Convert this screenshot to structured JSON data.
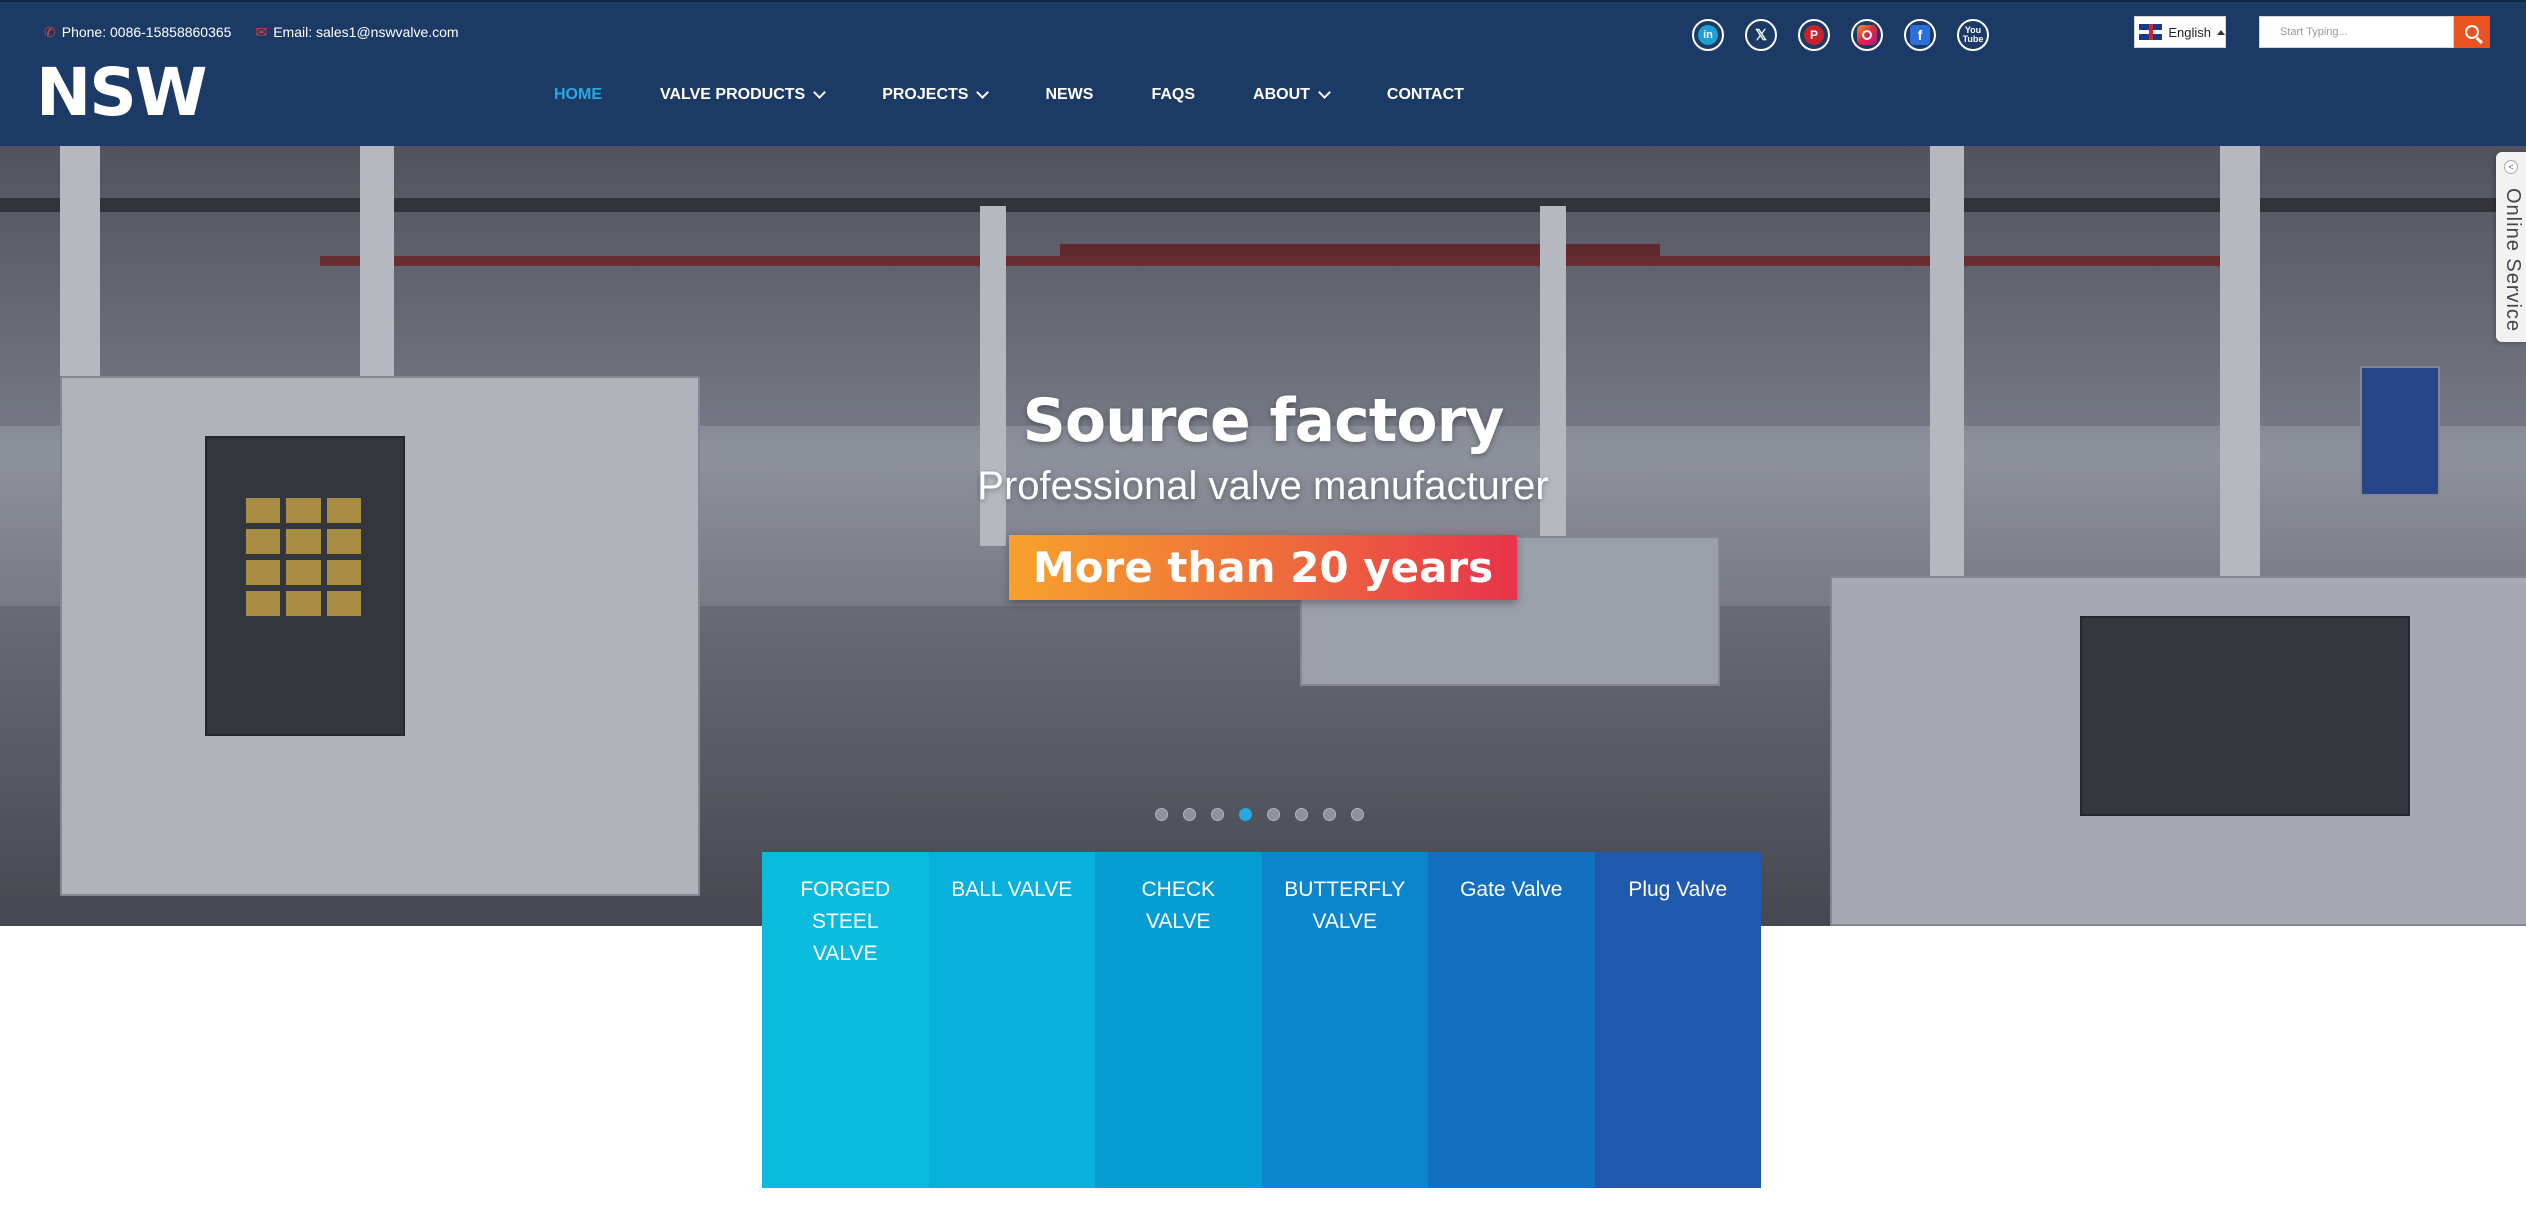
{
  "topbar": {
    "phone": "Phone: 0086-15858860365",
    "email": "Email: sales1@nswvalve.com",
    "phone_icon": "phone-icon",
    "email_icon": "mail-icon"
  },
  "logo": {
    "text": "NSW"
  },
  "nav": {
    "items": [
      {
        "label": "HOME",
        "active": true,
        "dropdown": false
      },
      {
        "label": "VALVE PRODUCTS",
        "active": false,
        "dropdown": true
      },
      {
        "label": "PROJECTS",
        "active": false,
        "dropdown": true
      },
      {
        "label": "NEWS",
        "active": false,
        "dropdown": false
      },
      {
        "label": "FAQS",
        "active": false,
        "dropdown": false
      },
      {
        "label": "ABOUT",
        "active": false,
        "dropdown": true
      },
      {
        "label": "CONTACT",
        "active": false,
        "dropdown": false
      }
    ],
    "active_color": "#2aa8e0"
  },
  "social": {
    "icons": [
      "linkedin-icon",
      "x-twitter-icon",
      "pinterest-icon",
      "instagram-icon",
      "facebook-icon",
      "youtube-icon"
    ],
    "youtube_label": "You Tube"
  },
  "language": {
    "selected": "English",
    "flag_icon": "uk-flag-icon"
  },
  "search": {
    "placeholder": "Start Typing...",
    "button_color": "#e8531f"
  },
  "hero": {
    "title": "Source factory",
    "subtitle": "Professional valve manufacturer",
    "badge": "More than 20 years",
    "slides_total": 8,
    "active_slide": 4
  },
  "online_service": {
    "label": "Online Service",
    "arrow": "<"
  },
  "categories": [
    {
      "label": "FORGED STEEL VALVE",
      "color": "#0bbbdd"
    },
    {
      "label": "BALL VALVE",
      "color": "#08b0dc"
    },
    {
      "label": "CHECK VALVE",
      "color": "#069dd3"
    },
    {
      "label": "BUTTERFLY VALVE",
      "color": "#0b85cb"
    },
    {
      "label": "Gate Valve",
      "color": "#136fbf"
    },
    {
      "label": "Plug Valve",
      "color": "#2059ae"
    }
  ],
  "colors": {
    "header_bg": "#1b3a66"
  }
}
